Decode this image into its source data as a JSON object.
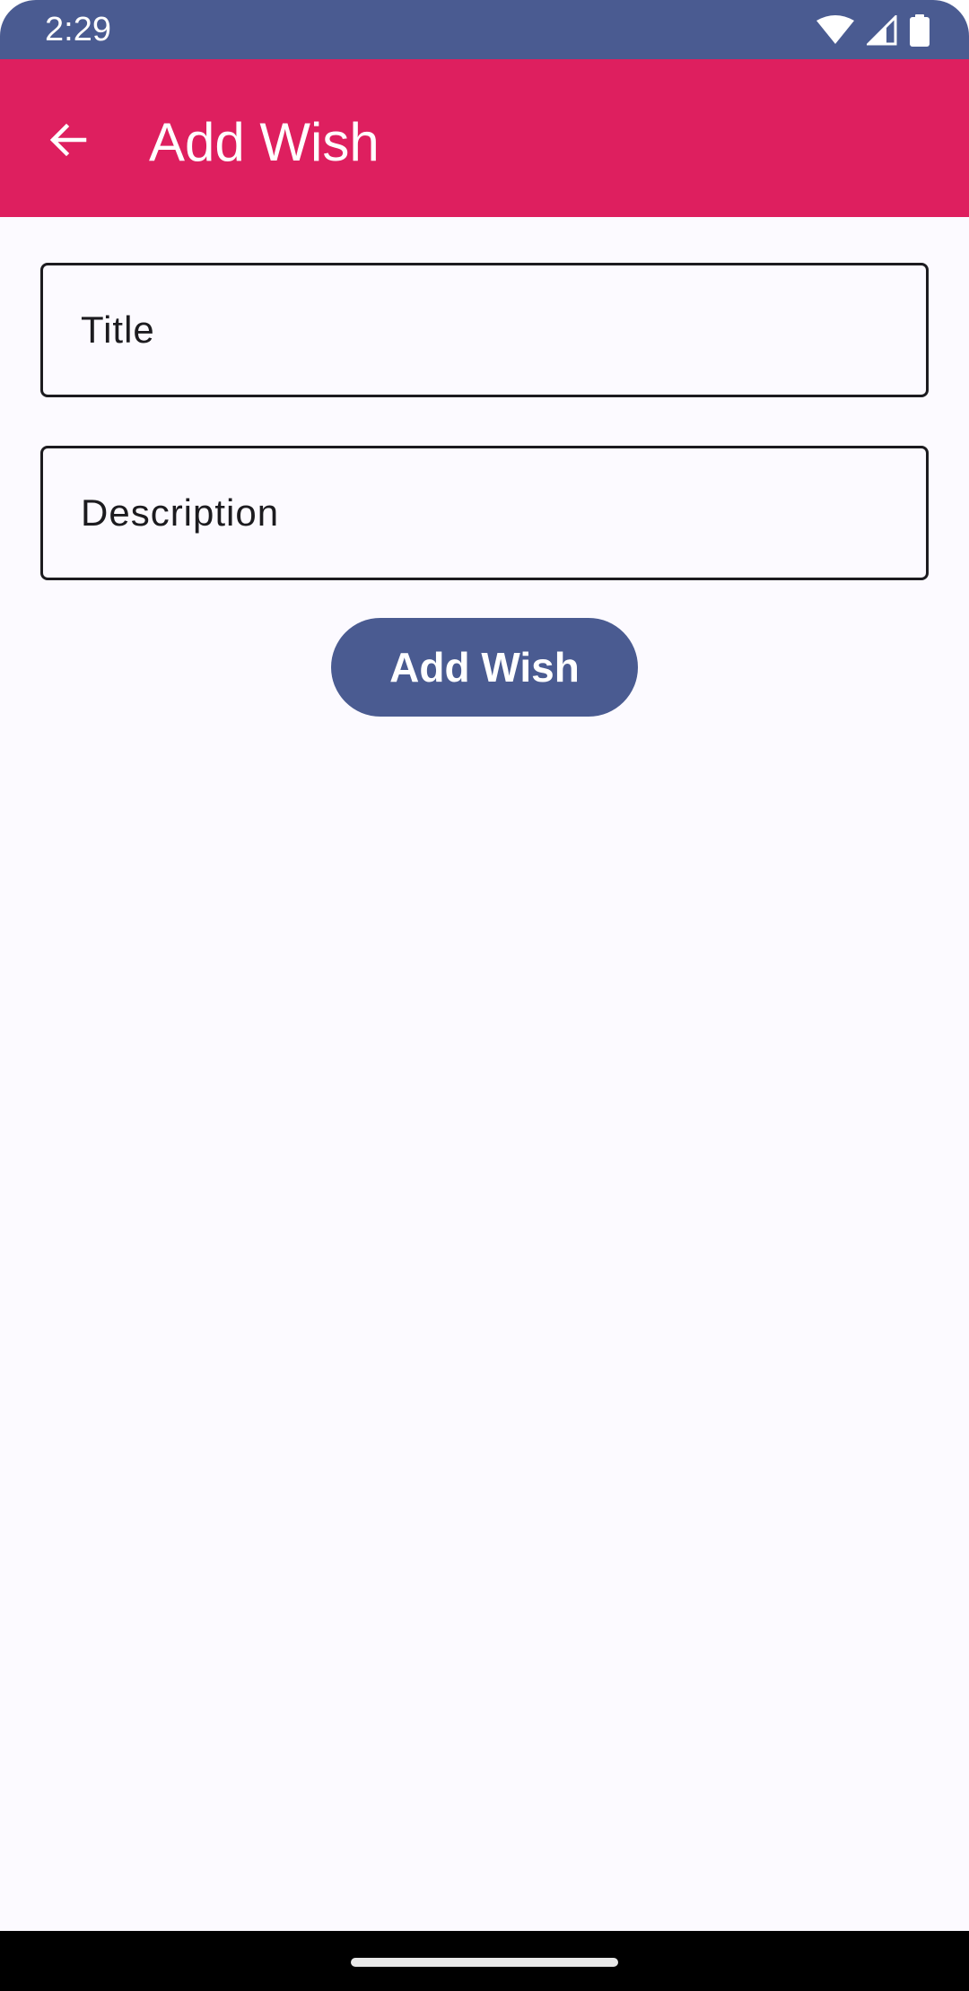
{
  "status_bar": {
    "time": "2:29",
    "icons": [
      "wifi-icon",
      "cellular-signal-icon",
      "battery-icon"
    ]
  },
  "app_bar": {
    "title": "Add Wish",
    "back_icon": "arrow-back-icon"
  },
  "form": {
    "title_field": {
      "placeholder": "Title",
      "value": ""
    },
    "description_field": {
      "placeholder": "Description",
      "value": ""
    },
    "submit_label": "Add Wish"
  },
  "colors": {
    "status_bar": "#4a5b91",
    "app_bar": "#de1f5f",
    "button": "#4a5b91",
    "background": "#fcfaff",
    "outline": "#1c1b1f"
  }
}
